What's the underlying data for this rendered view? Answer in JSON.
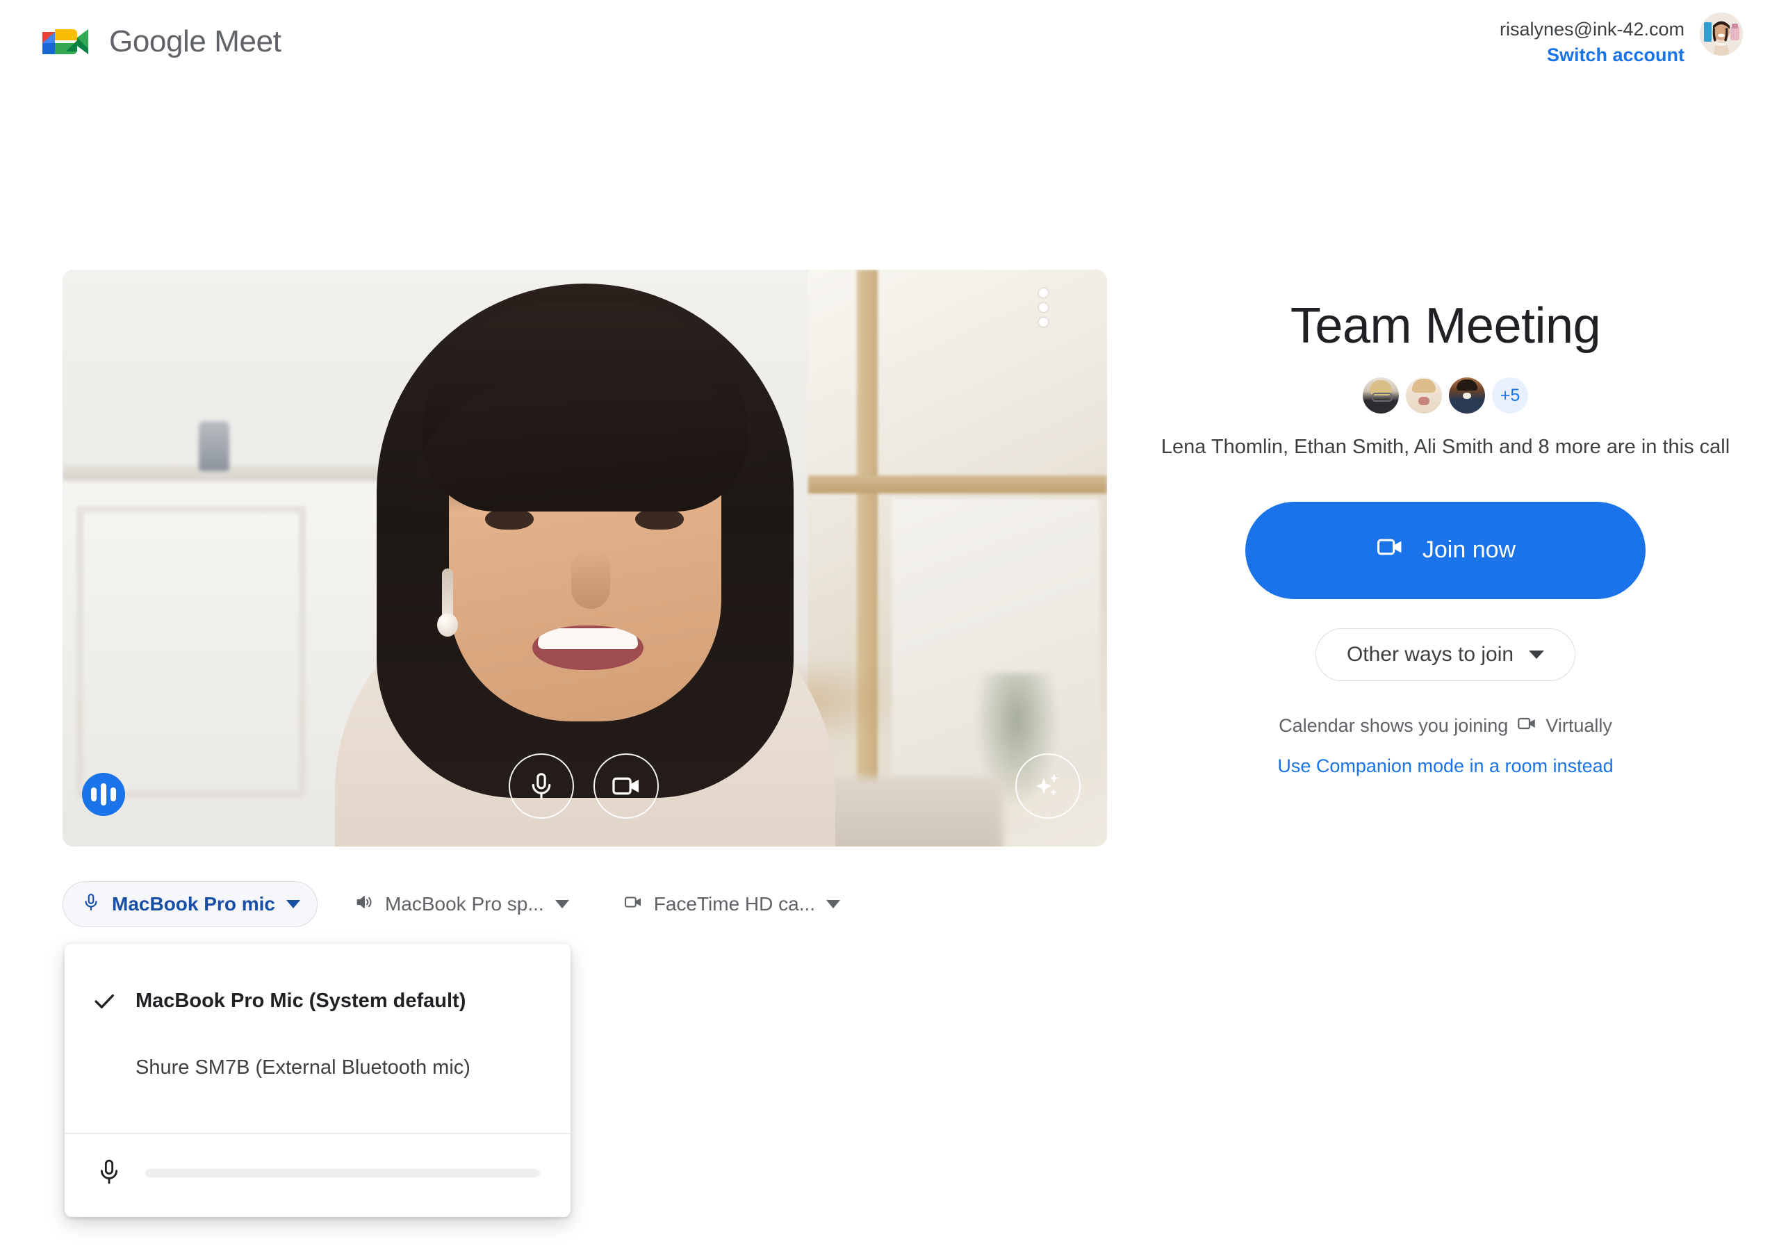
{
  "header": {
    "brand": "Google Meet",
    "logo_icon": "meet-logo-icon",
    "account_email": "risalynes@ink-42.com",
    "switch_account": "Switch account",
    "avatar_icon": "account-avatar"
  },
  "preview": {
    "more_icon": "more-vert-icon",
    "audio_indicator_icon": "audio-level-icon",
    "controls": [
      {
        "name": "mic-toggle",
        "icon": "microphone-icon"
      },
      {
        "name": "camera-toggle",
        "icon": "videocam-icon"
      },
      {
        "name": "effects",
        "icon": "sparkle-effects-icon"
      }
    ]
  },
  "meeting": {
    "title": "Team Meeting",
    "overflow_count": "+5",
    "participants_line": "Lena Thomlin, Ethan Smith, Ali Smith and 8 more are in this call",
    "participant_names": [
      "Lena Thomlin",
      "Ethan Smith",
      "Ali Smith"
    ],
    "more_count": 8,
    "join_label": "Join now",
    "join_icon": "videocam-icon",
    "other_ways_label": "Other ways to join",
    "calendar_prefix": "Calendar shows you joining",
    "calendar_mode": "Virtually",
    "calendar_icon": "videocam-icon",
    "companion_link": "Use Companion mode in a room instead"
  },
  "devices": {
    "mic_chip": {
      "label": "MacBook Pro mic",
      "icon": "microphone-icon"
    },
    "speaker_chip": {
      "label": "MacBook Pro sp...",
      "icon": "speaker-icon"
    },
    "camera_chip": {
      "label": "FaceTime HD ca...",
      "icon": "videocam-icon"
    }
  },
  "mic_dropdown": {
    "options": [
      {
        "label": "MacBook Pro Mic (System default)",
        "selected": true,
        "check_icon": "check-icon"
      },
      {
        "label": "Shure SM7B  (External Bluetooth mic)",
        "selected": false
      }
    ],
    "meter_icon": "microphone-icon",
    "meter_level_percent": 8
  },
  "colors": {
    "accent_blue": "#1a73e8",
    "active_chip_text": "#174ea6",
    "chip_fill": "#f5f7fa",
    "text_primary": "#202124",
    "text_secondary": "#5f6368",
    "badge_bg": "#e8f0fe"
  }
}
